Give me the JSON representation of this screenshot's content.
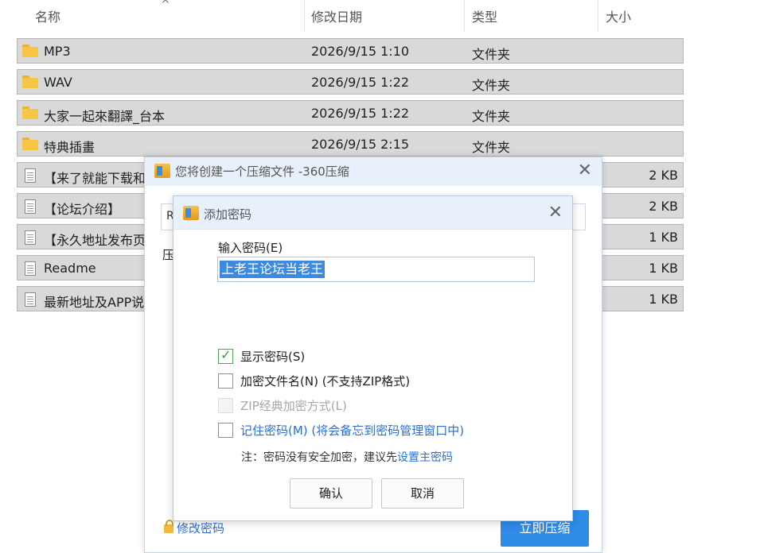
{
  "explorer": {
    "columns": {
      "name": "名称",
      "modified": "修改日期",
      "type": "类型",
      "size": "大小"
    },
    "sort_indicator": "^",
    "files": [
      {
        "icon": "folder-icon",
        "name": "MP3",
        "modified": "2026/9/15 1:10",
        "type": "文件夹",
        "size": ""
      },
      {
        "icon": "folder-icon",
        "name": "WAV",
        "modified": "2026/9/15 1:22",
        "type": "文件夹",
        "size": ""
      },
      {
        "icon": "folder-icon",
        "name": "大家一起來翻譯_台本",
        "modified": "2026/9/15 1:22",
        "type": "文件夹",
        "size": ""
      },
      {
        "icon": "folder-icon",
        "name": "特典插畫",
        "modified": "2026/9/15 2:15",
        "type": "文件夹",
        "size": ""
      },
      {
        "icon": "document-icon",
        "name": "【来了就能下载和",
        "modified": "",
        "type": "",
        "size": "2 KB"
      },
      {
        "icon": "document-icon",
        "name": "【论坛介绍】",
        "modified": "",
        "type": "",
        "size": "2 KB"
      },
      {
        "icon": "document-icon",
        "name": "【永久地址发布页",
        "modified": "",
        "type": "",
        "size": "1 KB"
      },
      {
        "icon": "document-icon",
        "name": "Readme",
        "modified": "",
        "type": "",
        "size": "1 KB"
      },
      {
        "icon": "document-icon",
        "name": "最新地址及APP说",
        "modified": "",
        "type": "",
        "size": "1 KB"
      }
    ]
  },
  "archive_dialog": {
    "title": "您将创建一个压缩文件 -360压缩",
    "field_value": "R",
    "field_label": "压",
    "modify_password": "修改密码",
    "compress_button": "立即压缩"
  },
  "password_dialog": {
    "title": "添加密码",
    "input_label": "输入密码(E)",
    "password_value": "上老王论坛当老王",
    "options": {
      "show_password": "显示密码(S)",
      "encrypt_filenames": "加密文件名(N) (不支持ZIP格式)",
      "zip_classic": "ZIP经典加密方式(L)",
      "remember_password": "记住密码(M) (将会备忘到密码管理窗口中)"
    },
    "note_prefix": "注：密码没有安全加密，建议先",
    "note_link": "设置主密码",
    "ok_button": "确认",
    "cancel_button": "取消"
  },
  "colors": {
    "accent": "#2f8be6",
    "link": "#2a6fd6",
    "titlebar": "#e8f0fb",
    "selection": "#3b8ae0"
  }
}
